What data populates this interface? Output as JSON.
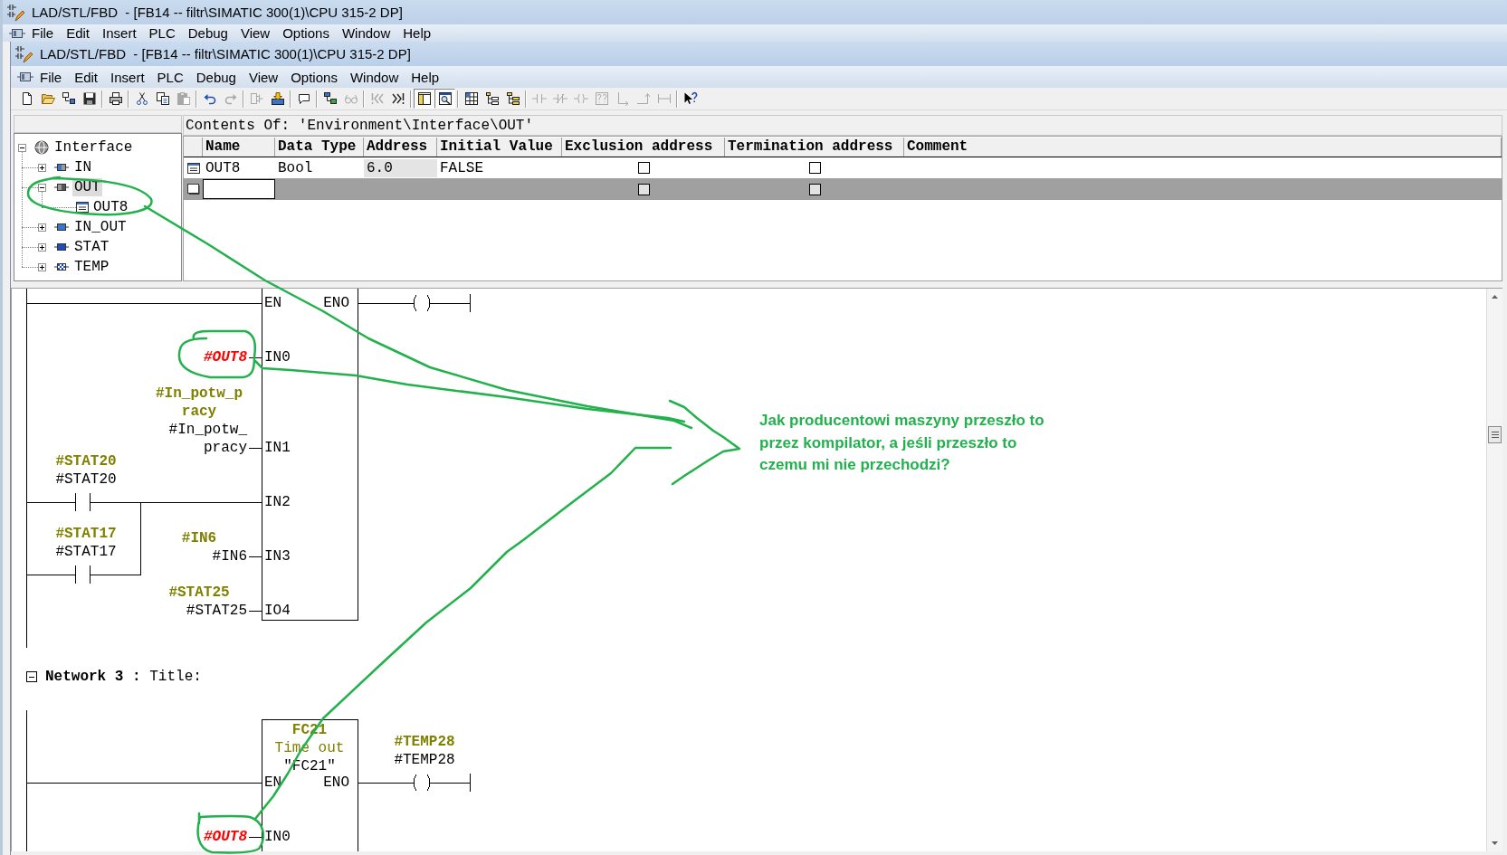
{
  "background_window": {
    "title": "LAD/STL/FBD  - [FB14 -- filtr\\SIMATIC 300(1)\\CPU 315-2 DP]",
    "menu": [
      "File",
      "Edit",
      "Insert",
      "PLC",
      "Debug",
      "View",
      "Options",
      "Window",
      "Help"
    ]
  },
  "window": {
    "title": "LAD/STL/FBD  - [FB14 -- filtr\\SIMATIC 300(1)\\CPU 315-2 DP]"
  },
  "menu": [
    "File",
    "Edit",
    "Insert",
    "PLC",
    "Debug",
    "View",
    "Options",
    "Window",
    "Help"
  ],
  "toolbar": [
    [
      {
        "disabled": false,
        "pressed": false
      },
      {
        "disabled": false,
        "pressed": false
      },
      {
        "disabled": false,
        "pressed": false
      },
      {
        "disabled": false,
        "pressed": false
      }
    ],
    [
      {
        "disabled": false,
        "pressed": false
      }
    ],
    [
      {
        "disabled": false,
        "pressed": false
      },
      {
        "disabled": false,
        "pressed": false
      },
      {
        "disabled": true,
        "pressed": false
      }
    ],
    [
      {
        "disabled": false,
        "pressed": false
      },
      {
        "disabled": true,
        "pressed": false
      }
    ],
    [
      {
        "disabled": true,
        "pressed": false
      },
      {
        "disabled": false,
        "pressed": false
      }
    ],
    [
      {
        "disabled": false,
        "pressed": false
      }
    ],
    [
      {
        "disabled": false,
        "pressed": false
      },
      {
        "disabled": true,
        "pressed": false
      }
    ],
    [
      {
        "disabled": true,
        "pressed": false
      },
      {
        "disabled": false,
        "pressed": false
      }
    ],
    [
      {
        "disabled": false,
        "pressed": true
      },
      {
        "disabled": false,
        "pressed": true
      }
    ],
    [
      {
        "disabled": false,
        "pressed": false
      },
      {
        "disabled": false,
        "pressed": false
      },
      {
        "disabled": false,
        "pressed": false
      }
    ],
    [
      {
        "disabled": true,
        "pressed": false
      },
      {
        "disabled": true,
        "pressed": false
      },
      {
        "disabled": true,
        "pressed": false
      },
      {
        "disabled": true,
        "pressed": false
      },
      {
        "disabled": true,
        "pressed": false
      },
      {
        "disabled": true,
        "pressed": false
      },
      {
        "disabled": true,
        "pressed": false
      }
    ],
    [
      {
        "disabled": false,
        "pressed": false
      }
    ]
  ],
  "tree": {
    "label": "Interface",
    "kind": "root",
    "expanded": true,
    "selected": false,
    "children": [
      {
        "label": "IN",
        "kind": "in",
        "expanded": false,
        "selected": false
      },
      {
        "label": "OUT",
        "kind": "out",
        "expanded": true,
        "selected": true,
        "children": [
          {
            "label": "OUT8",
            "kind": "variable",
            "selected": false
          }
        ]
      },
      {
        "label": "IN_OUT",
        "kind": "in_out",
        "expanded": false,
        "selected": false
      },
      {
        "label": "STAT",
        "kind": "stat",
        "expanded": false,
        "selected": false
      },
      {
        "label": "TEMP",
        "kind": "temp",
        "expanded": false,
        "selected": false
      }
    ]
  },
  "contents": {
    "title": "Contents Of: 'Environment\\Interface\\OUT'",
    "columns": [
      "Name",
      "Data Type",
      "Address",
      "Initial Value",
      "Exclusion address",
      "Termination address",
      "Comment"
    ],
    "rows": [
      {
        "kind": "variable",
        "selected": false,
        "name": "OUT8",
        "data_type": "Bool",
        "address": "6.0",
        "initial_value": "FALSE",
        "exclusion_address": {
          "checked": false
        },
        "termination_address": {
          "checked": false
        }
      },
      {
        "kind": "new",
        "selected": true,
        "exclusion_address": {
          "checked": false
        },
        "termination_address": {
          "checked": false
        }
      }
    ]
  },
  "ladder": {
    "networks": [
      {
        "block": {
          "en": "EN",
          "eno": "ENO",
          "inputs": [
            {
              "pin": "IN0",
              "operand": [
                "#OUT8"
              ],
              "error": true
            },
            {
              "pin": "IN1",
              "comment": [
                "#In_potw_p",
                "racy"
              ],
              "operand": [
                "#In_potw_",
                "pracy"
              ],
              "error": false
            },
            {
              "pin": "IN2"
            },
            {
              "pin": "IN3",
              "comment": [
                "#IN6"
              ],
              "operand": [
                "#IN6"
              ],
              "error": false
            },
            {
              "pin": "IO4",
              "comment": [
                "#STAT25"
              ],
              "operand": [
                "#STAT25"
              ],
              "error": false
            }
          ]
        },
        "contacts": [
          {
            "comment": "#STAT20",
            "operand": "#STAT20"
          },
          {
            "comment": "#STAT17",
            "operand": "#STAT17"
          }
        ]
      },
      {
        "heading": {
          "expanded": true,
          "title": "**Network 3 :** Title:"
        },
        "block": {
          "symbol": "FC21",
          "symbol_comment": "Time out",
          "name": "\"FC21\"",
          "en": "EN",
          "eno": "ENO",
          "inputs": [
            {
              "pin": "IN0",
              "operand": [
                "#OUT8"
              ],
              "error": true
            }
          ]
        },
        "coil": {
          "comment": "#TEMP28",
          "operand": "#TEMP28"
        }
      }
    ]
  },
  "annotation": {
    "text": "Jak producentowi maszyny przeszło to przez kompilator, a jeśli przeszło to czemu mi nie przechodzi?"
  }
}
